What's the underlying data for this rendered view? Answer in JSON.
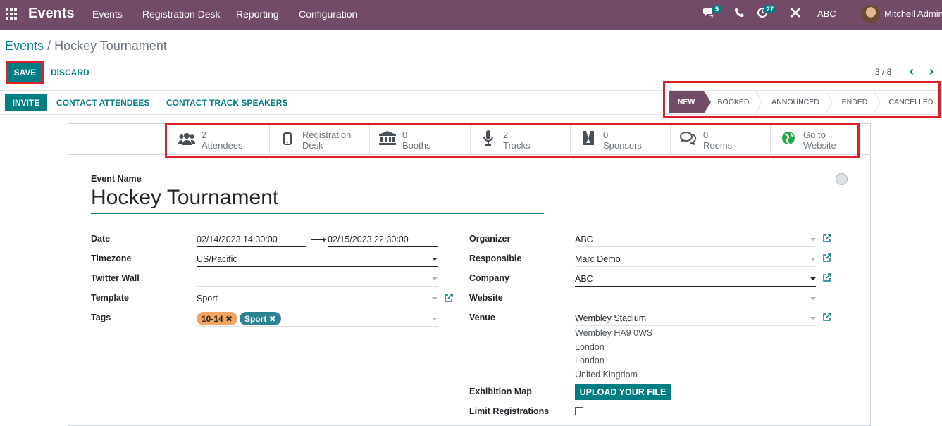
{
  "navbar": {
    "brand": "Events",
    "menu": [
      "Events",
      "Registration Desk",
      "Reporting",
      "Configuration"
    ],
    "chat_badge": "5",
    "activity_badge": "27",
    "company": "ABC",
    "user": "Mitchell Admin"
  },
  "breadcrumb": {
    "parent": "Events",
    "separator": "/",
    "current": "Hockey Tournament"
  },
  "control": {
    "save": "SAVE",
    "discard": "DISCARD",
    "pager": "3 / 8"
  },
  "actions": {
    "invite": "INVITE",
    "contact_attendees": "CONTACT ATTENDEES",
    "contact_speakers": "CONTACT TRACK SPEAKERS"
  },
  "stages": [
    "NEW",
    "BOOKED",
    "ANNOUNCED",
    "ENDED",
    "CANCELLED"
  ],
  "smart_buttons": [
    {
      "value": "2",
      "label": "Attendees",
      "icon": "users-icon"
    },
    {
      "value": "Registration",
      "label": "Desk",
      "icon": "mobile-icon"
    },
    {
      "value": "0",
      "label": "Booths",
      "icon": "bank-icon"
    },
    {
      "value": "2",
      "label": "Tracks",
      "icon": "microphone-icon"
    },
    {
      "value": "0",
      "label": "Sponsors",
      "icon": "ribbon-icon"
    },
    {
      "value": "0",
      "label": "Rooms",
      "icon": "comments-icon"
    },
    {
      "value": "Go to",
      "label": "Website",
      "icon": "globe-icon"
    }
  ],
  "form": {
    "event_name_label": "Event Name",
    "event_name": "Hockey Tournament",
    "date_label": "Date",
    "date_begin": "02/14/2023 14:30:00",
    "date_end": "02/15/2023 22:30:00",
    "timezone_label": "Timezone",
    "timezone": "US/Pacific",
    "twitter_label": "Twitter Wall",
    "template_label": "Template",
    "template": "Sport",
    "tags_label": "Tags",
    "tags": [
      "10-14",
      "Sport"
    ],
    "organizer_label": "Organizer",
    "organizer": "ABC",
    "responsible_label": "Responsible",
    "responsible": "Marc Demo",
    "company_label": "Company",
    "company": "ABC",
    "website_label": "Website",
    "venue_label": "Venue",
    "venue": "Wembley Stadium",
    "venue_address": [
      "Wembley HA9 0WS",
      "London",
      "London",
      "United Kingdom"
    ],
    "exhibition_label": "Exhibition Map",
    "upload": "UPLOAD YOUR FILE",
    "limit_label": "Limit Registrations"
  },
  "colors": {
    "navbar": "#714b67",
    "primary": "#017e84",
    "highlight": "#e01e26"
  }
}
